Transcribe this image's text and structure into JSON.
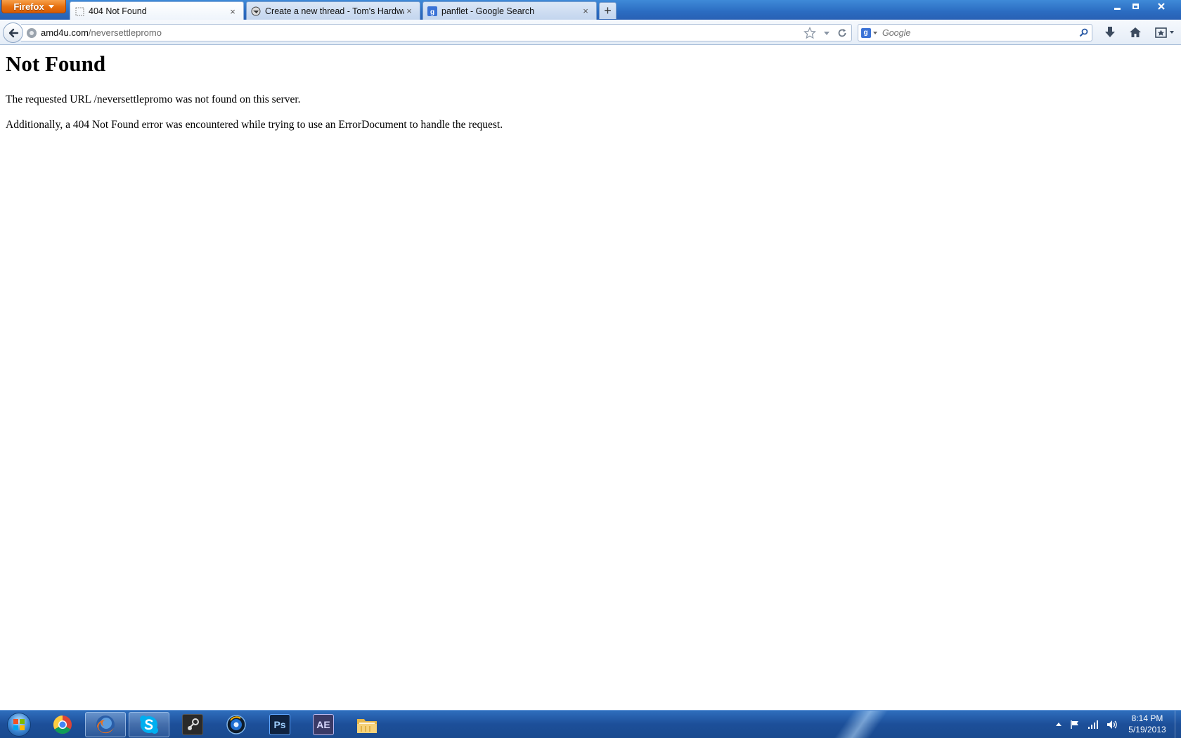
{
  "browser": {
    "menu_button": "Firefox",
    "tabs": [
      {
        "title": "404 Not Found",
        "active": true
      },
      {
        "title": "Create a new thread - Tom's Hardware",
        "active": false
      },
      {
        "title": "panflet - Google Search",
        "active": false
      }
    ],
    "new_tab_label": "+",
    "close_label": "×",
    "url": {
      "domain": "amd4u.com",
      "path": "/neversettlepromo"
    },
    "search": {
      "placeholder": "Google",
      "engine_letter": "g"
    }
  },
  "page": {
    "title": "Not Found",
    "paragraphs": [
      "The requested URL /neversettlepromo was not found on this server.",
      "Additionally, a 404 Not Found error was encountered while trying to use an ErrorDocument to handle the request."
    ]
  },
  "taskbar": {
    "apps": [
      {
        "name": "Google Chrome",
        "icon": "chrome-icon",
        "running": false
      },
      {
        "name": "Firefox",
        "icon": "firefox-icon",
        "running": true
      },
      {
        "name": "Skype",
        "icon": "skype-icon",
        "running": true
      },
      {
        "name": "Steam",
        "icon": "steam-icon",
        "running": false
      },
      {
        "name": "Media Player",
        "icon": "media-player-icon",
        "running": false
      },
      {
        "name": "Photoshop",
        "icon": "photoshop-icon",
        "label": "Ps",
        "running": false
      },
      {
        "name": "After Effects",
        "icon": "after-effects-icon",
        "label": "AE",
        "running": false
      },
      {
        "name": "Windows Explorer",
        "icon": "folder-icon",
        "running": false
      }
    ],
    "clock": {
      "time": "8:14 PM",
      "date": "5/19/2013"
    }
  },
  "colors": {
    "titlebar": "#2b6cc1",
    "firefox_button": "#e66f0e",
    "taskbar": "#1c4f99",
    "photoshop": "#0f2340",
    "after_effects": "#3a3a66"
  }
}
